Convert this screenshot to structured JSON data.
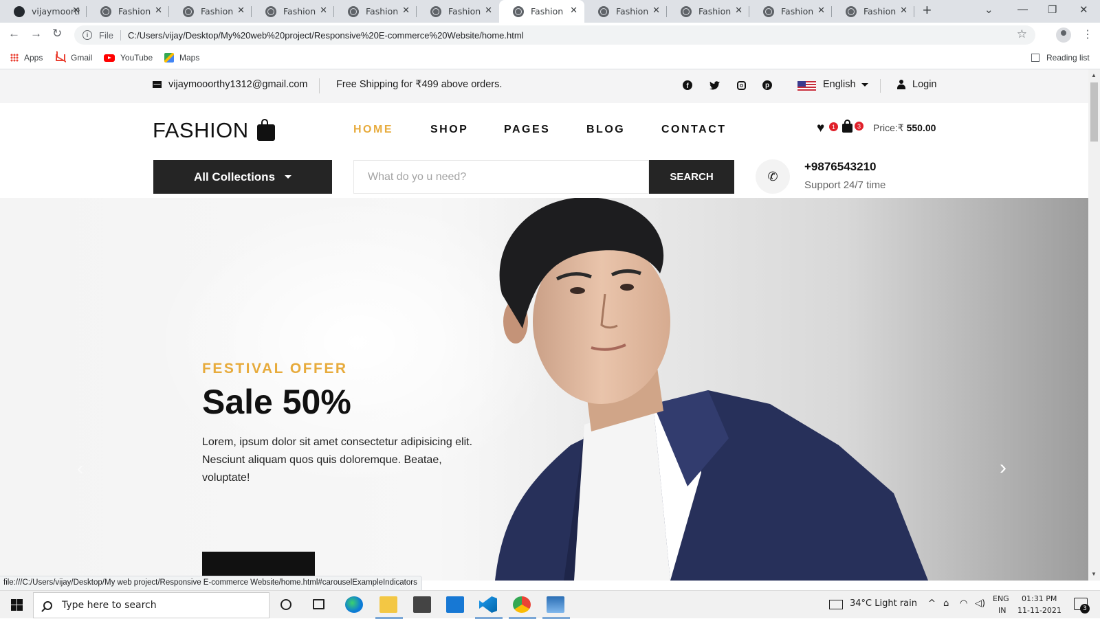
{
  "browser": {
    "tabs": [
      {
        "title": "vijaymoorthy",
        "favicon": "github-icon",
        "active": false
      },
      {
        "title": "Fashion",
        "favicon": "globe-icon",
        "active": false
      },
      {
        "title": "Fashion",
        "favicon": "globe-icon",
        "active": false
      },
      {
        "title": "Fashion",
        "favicon": "globe-icon",
        "active": false
      },
      {
        "title": "Fashion",
        "favicon": "globe-icon",
        "active": false
      },
      {
        "title": "Fashion",
        "favicon": "globe-icon",
        "active": false
      },
      {
        "title": "Fashion",
        "favicon": "globe-icon",
        "active": true
      },
      {
        "title": "Fashion",
        "favicon": "globe-icon",
        "active": false
      },
      {
        "title": "Fashion",
        "favicon": "globe-icon",
        "active": false
      },
      {
        "title": "Fashion",
        "favicon": "globe-icon",
        "active": false
      },
      {
        "title": "Fashion",
        "favicon": "globe-icon",
        "active": false
      }
    ],
    "omnibox": {
      "scheme": "File",
      "url": "C:/Users/vijay/Desktop/My%20web%20project/Responsive%20E-commerce%20Website/home.html"
    },
    "bookmarks": [
      {
        "label": "Apps",
        "icon": "apps-grid-icon"
      },
      {
        "label": "Gmail",
        "icon": "gmail-icon"
      },
      {
        "label": "YouTube",
        "icon": "youtube-icon"
      },
      {
        "label": "Maps",
        "icon": "maps-icon"
      }
    ],
    "reading_list": "Reading list",
    "status_url": "file:///C:/Users/vijay/Desktop/My web project/Responsive E-commerce Website/home.html#carouselExampleIndicators"
  },
  "site": {
    "topbar": {
      "email": "vijaymooorthy1312@gmail.com",
      "shipping": "Free Shipping for ₹499 above orders.",
      "language": "English",
      "login": "Login"
    },
    "logo": "FASHION",
    "nav": [
      {
        "label": "HOME",
        "active": true
      },
      {
        "label": "SHOP",
        "active": false
      },
      {
        "label": "PAGES",
        "active": false
      },
      {
        "label": "BLOG",
        "active": false
      },
      {
        "label": "CONTACT",
        "active": false
      }
    ],
    "wishlist_count": "1",
    "cart_count": "3",
    "price_label": "Price:₹",
    "price_value": "550.00",
    "all_collections": "All Collections",
    "search_placeholder": "What do yo u need?",
    "search_button": "SEARCH",
    "phone": "+9876543210",
    "support": "Support 24/7 time",
    "hero": {
      "kicker": "FESTIVAL OFFER",
      "headline": "Sale 50%",
      "description": "Lorem, ipsum dolor sit amet consectetur adipisicing elit. Nesciunt aliquam quos quis doloremque. Beatae, voluptate!"
    },
    "accent_color": "#e7ab3c"
  },
  "taskbar": {
    "search_placeholder": "Type here to search",
    "weather": "34°C  Light rain",
    "lang_top": "ENG",
    "lang_bottom": "IN",
    "time": "01:31 PM",
    "date": "11-11-2021",
    "notifications": "3",
    "apps": [
      "edge-icon",
      "file-explorer-icon",
      "store-icon",
      "mail-icon",
      "vscode-icon",
      "chrome-icon",
      "photos-icon"
    ]
  }
}
